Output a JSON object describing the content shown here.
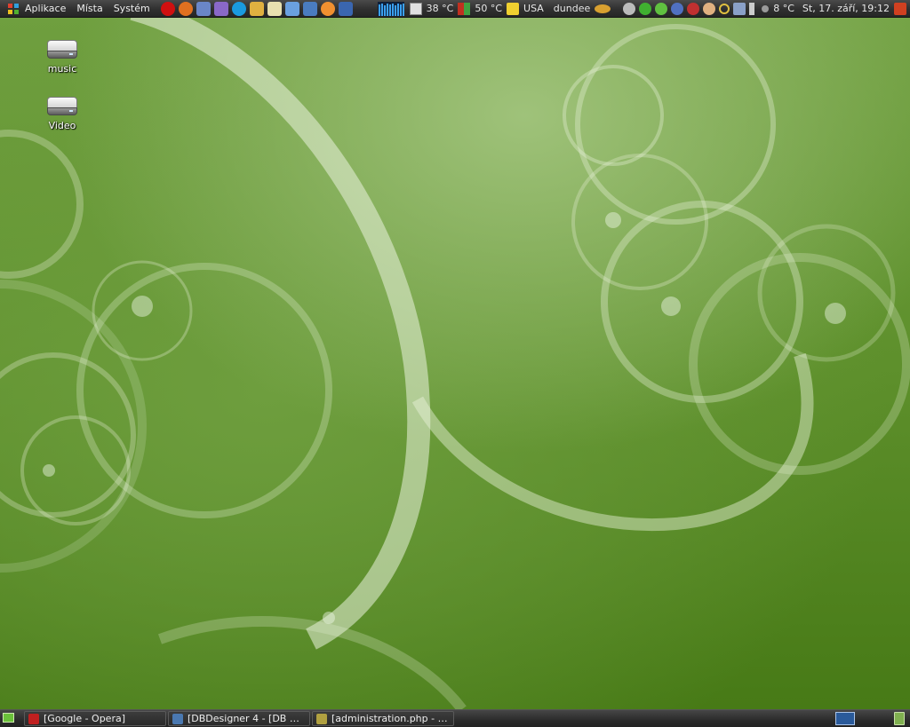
{
  "top_panel": {
    "menus": [
      "Aplikace",
      "Místa",
      "Systém"
    ],
    "launchers": [
      {
        "name": "opera-icon",
        "color": "#d01010"
      },
      {
        "name": "firefox-icon",
        "color": "#e07020"
      },
      {
        "name": "messenger-icon",
        "color": "#6a86c8"
      },
      {
        "name": "pidgin-icon",
        "color": "#8a68c8"
      },
      {
        "name": "skype-icon",
        "color": "#1a9ae0"
      },
      {
        "name": "user-icon",
        "color": "#e0b040"
      },
      {
        "name": "text-editor-icon",
        "color": "#e8e0b0"
      },
      {
        "name": "package-icon",
        "color": "#6aa0e0"
      },
      {
        "name": "network-icon",
        "color": "#4a7cc0"
      },
      {
        "name": "clock-icon",
        "color": "#f09030"
      },
      {
        "name": "system-monitor-icon",
        "color": "#3a66b0"
      }
    ],
    "temp_cpu": "38 °C",
    "temp_hdd": "50 °C",
    "keyboard_layout": "USA",
    "username": "dundee",
    "weather_temp": "8 °C",
    "datetime": "St, 17. září, 19:12"
  },
  "desktop_icons": [
    {
      "label": "music"
    },
    {
      "label": "Video"
    }
  ],
  "taskbar": {
    "tasks": [
      {
        "label": "[Google - Opera]",
        "icon": "opera-icon",
        "color": "#c02020"
      },
      {
        "label": "[DBDesigner 4 - [DB M...",
        "icon": "dbdesigner-icon",
        "color": "#4a78b0"
      },
      {
        "label": "[administration.php - /h...",
        "icon": "editor-icon",
        "color": "#b0a040"
      }
    ]
  },
  "colors": {
    "wallpaper_green": "#5e902c",
    "panel_dark": "#2f2f2f"
  }
}
